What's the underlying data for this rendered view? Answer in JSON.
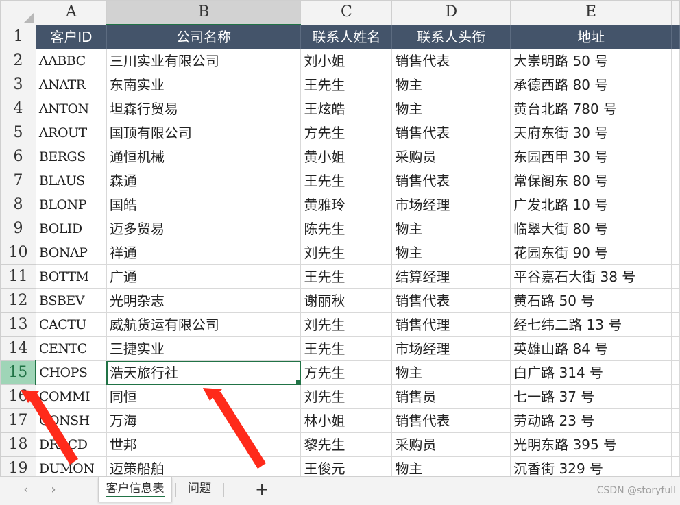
{
  "columns": [
    "A",
    "B",
    "C",
    "D",
    "E"
  ],
  "active_column": "B",
  "active_row": 15,
  "header_row": {
    "row_number": "1",
    "cells": [
      "客户ID",
      "公司名称",
      "联系人姓名",
      "联系人头衔",
      "地址"
    ]
  },
  "rows": [
    {
      "n": "2",
      "cells": [
        "AABBC",
        "三川实业有限公司",
        "刘小姐",
        "销售代表",
        "大崇明路 50 号"
      ]
    },
    {
      "n": "3",
      "cells": [
        "ANATR",
        "东南实业",
        "王先生",
        "物主",
        "承德西路 80 号"
      ]
    },
    {
      "n": "4",
      "cells": [
        "ANTON",
        "坦森行贸易",
        "王炫皓",
        "物主",
        "黄台北路 780 号"
      ]
    },
    {
      "n": "5",
      "cells": [
        "AROUT",
        "国顶有限公司",
        "方先生",
        "销售代表",
        "天府东街 30 号"
      ]
    },
    {
      "n": "6",
      "cells": [
        "BERGS",
        "通恒机械",
        "黄小姐",
        "采购员",
        "东园西甲 30 号"
      ]
    },
    {
      "n": "7",
      "cells": [
        "BLAUS",
        "森通",
        "王先生",
        "销售代表",
        "常保阁东 80 号"
      ]
    },
    {
      "n": "8",
      "cells": [
        "BLONP",
        "国皓",
        "黄雅玲",
        "市场经理",
        "广发北路 10 号"
      ]
    },
    {
      "n": "9",
      "cells": [
        "BOLID",
        "迈多贸易",
        "陈先生",
        "物主",
        "临翠大街 80 号"
      ]
    },
    {
      "n": "10",
      "cells": [
        "BONAP",
        "祥通",
        "刘先生",
        "物主",
        "花园东街 90 号"
      ]
    },
    {
      "n": "11",
      "cells": [
        "BOTTM",
        "广通",
        "王先生",
        "结算经理",
        "平谷嘉石大街 38 号"
      ]
    },
    {
      "n": "12",
      "cells": [
        "BSBEV",
        "光明杂志",
        "谢丽秋",
        "销售代表",
        "黄石路 50 号"
      ]
    },
    {
      "n": "13",
      "cells": [
        "CACTU",
        "威航货运有限公司",
        "刘先生",
        "销售代理",
        "经七纬二路 13 号"
      ]
    },
    {
      "n": "14",
      "cells": [
        "CENTC",
        "三捷实业",
        "王先生",
        "市场经理",
        "英雄山路 84 号"
      ]
    },
    {
      "n": "15",
      "cells": [
        "CHOPS",
        "浩天旅行社",
        "方先生",
        "物主",
        "白广路 314 号"
      ]
    },
    {
      "n": "16",
      "cells": [
        "COMMI",
        "同恒",
        "刘先生",
        "销售员",
        "七一路 37 号"
      ]
    },
    {
      "n": "17",
      "cells": [
        "CONSH",
        "万海",
        "林小姐",
        "销售代表",
        "劳动路 23 号"
      ]
    },
    {
      "n": "18",
      "cells": [
        "DRACD",
        "世邦",
        "黎先生",
        "采购员",
        "光明东路 395 号"
      ]
    },
    {
      "n": "19",
      "cells": [
        "DUMON",
        "迈策船舶",
        "王俊元",
        "物主",
        "沉香街 329 号"
      ]
    }
  ],
  "tabs": {
    "prev_icon": "chevron-left-icon",
    "next_icon": "chevron-right-icon",
    "prev_glyph": "‹",
    "next_glyph": "›",
    "sheets": [
      "客户信息表",
      "问题"
    ],
    "active_sheet": "客户信息表",
    "add_glyph": "+"
  },
  "watermark": "CSDN @storyfull",
  "colors": {
    "header_fill": "#44546a",
    "accent_green": "#217346",
    "active_row_head": "#9fd5b7",
    "annotation_red": "#ff2a1a"
  }
}
